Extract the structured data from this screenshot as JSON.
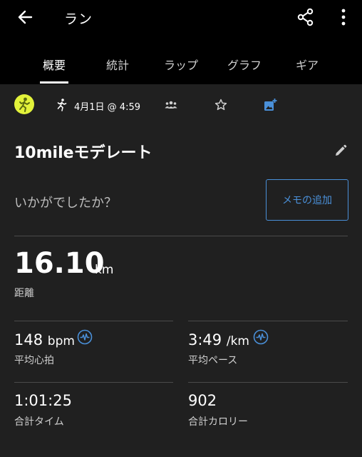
{
  "header": {
    "title": "ラン",
    "back_icon": "arrow-left-icon",
    "share_icon": "share-icon",
    "more_icon": "more-vertical-icon"
  },
  "tabs": [
    {
      "label": "概要",
      "active": true
    },
    {
      "label": "統計",
      "active": false
    },
    {
      "label": "ラップ",
      "active": false
    },
    {
      "label": "グラフ",
      "active": false
    },
    {
      "label": "ギア",
      "active": false
    }
  ],
  "meta": {
    "date": "4月1日 @ 4:59",
    "badge_color": "#e2f23a",
    "accent_color": "#4a90d9"
  },
  "activity": {
    "name": "10mileモデレート",
    "prompt": "いかがでしたか？",
    "memo_button": "メモの追加"
  },
  "distance": {
    "value": "16.10",
    "unit": "km",
    "label": "距離"
  },
  "stats": {
    "heart_rate": {
      "value": "148",
      "unit": "bpm",
      "label": "平均心拍"
    },
    "pace": {
      "value": "3:49",
      "unit": "/km",
      "label": "平均ペース"
    },
    "time": {
      "value": "1:01:25",
      "label": "合計タイム"
    },
    "calories": {
      "value": "902",
      "label": "合計カロリー"
    }
  }
}
